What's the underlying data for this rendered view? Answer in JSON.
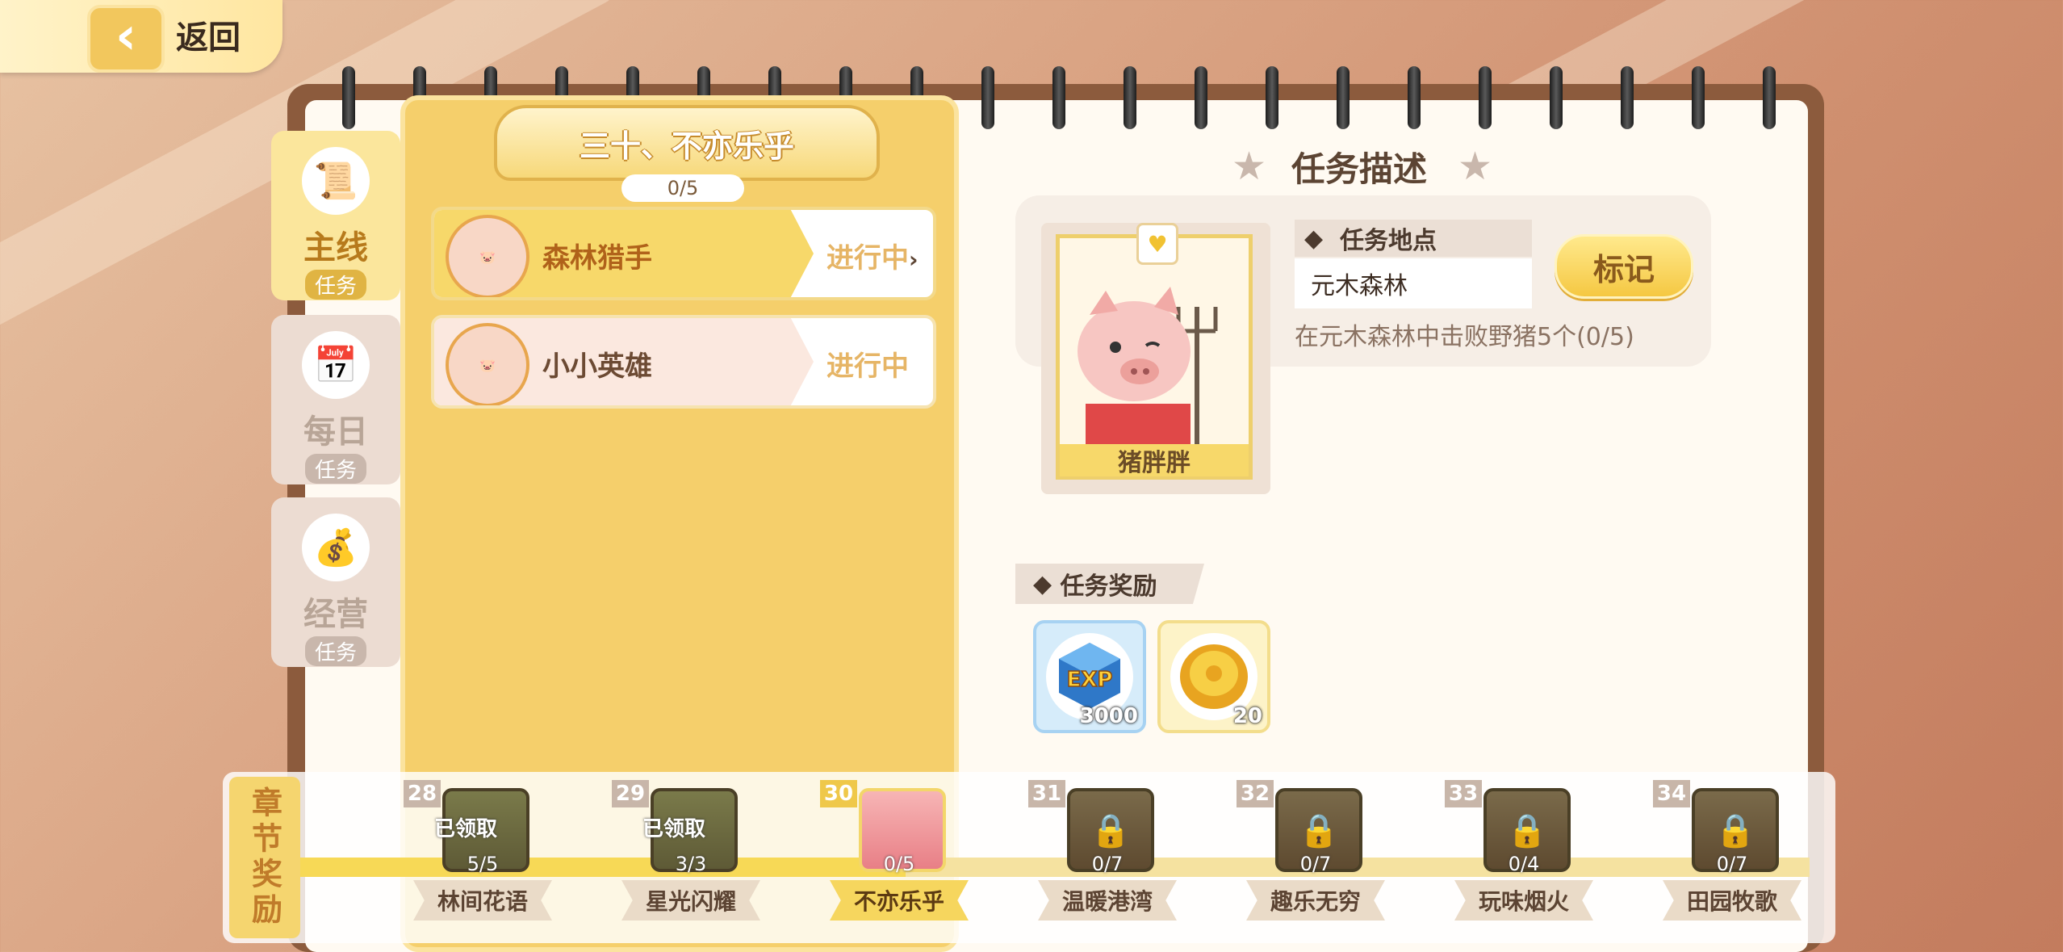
{
  "header": {
    "back_label": "返回"
  },
  "side_tabs": [
    {
      "title": "主线",
      "sub": "任务",
      "icon": "scroll-star-icon",
      "active": true
    },
    {
      "title": "每日",
      "sub": "任务",
      "icon": "calendar-check-icon",
      "active": false
    },
    {
      "title": "经营",
      "sub": "任务",
      "icon": "money-bag-icon",
      "active": false
    }
  ],
  "chapter": {
    "title": "三十、不亦乐乎",
    "progress": "0/5"
  },
  "quests": [
    {
      "name": "森林猎手",
      "status": "进行中",
      "selected": true
    },
    {
      "name": "小小英雄",
      "status": "进行中",
      "selected": false
    }
  ],
  "detail": {
    "title": "任务描述",
    "npc_name": "猪胖胖",
    "location_label": "任务地点",
    "location_value": "元木森林",
    "mark_button": "标记",
    "description": "在元木森林中击败野猪5个(0/5)",
    "reward_label": "任务奖励",
    "rewards": [
      {
        "icon": "exp-cube-icon",
        "count": "3000"
      },
      {
        "icon": "gold-coin-icon",
        "count": "20"
      }
    ]
  },
  "chapter_rewards": {
    "label": "章节奖励",
    "items": [
      {
        "num": "28",
        "name": "林间花语",
        "progress": "5/5",
        "state": "已领取"
      },
      {
        "num": "29",
        "name": "星光闪耀",
        "progress": "3/3",
        "state": "已领取"
      },
      {
        "num": "30",
        "name": "不亦乐乎",
        "progress": "0/5",
        "state": "current"
      },
      {
        "num": "31",
        "name": "温暖港湾",
        "progress": "0/7",
        "state": "locked"
      },
      {
        "num": "32",
        "name": "趣乐无穷",
        "progress": "0/7",
        "state": "locked"
      },
      {
        "num": "33",
        "name": "玩味烟火",
        "progress": "0/4",
        "state": "locked"
      },
      {
        "num": "34",
        "name": "田园牧歌",
        "progress": "0/7",
        "state": "locked"
      }
    ]
  },
  "colors": {
    "accent": "#f5cf6b",
    "book": "#8c5b3d",
    "status": "#e6b566"
  }
}
